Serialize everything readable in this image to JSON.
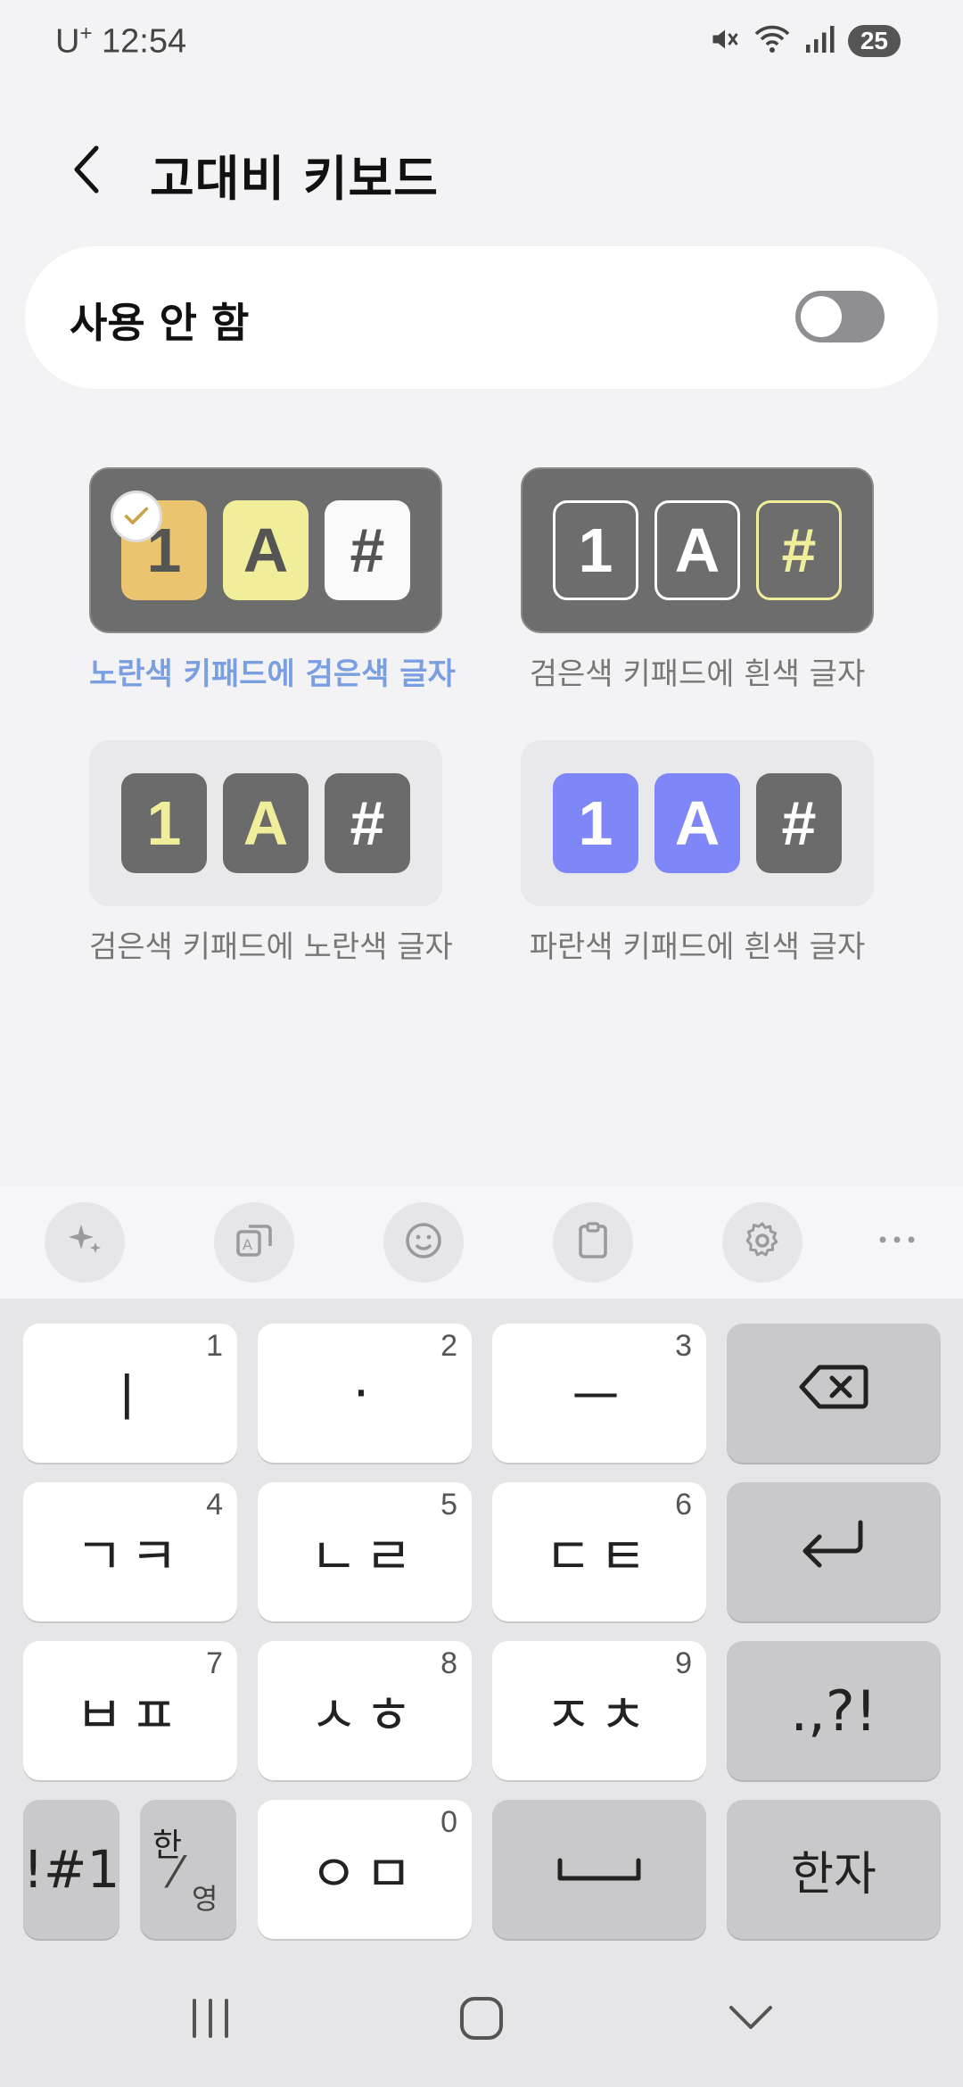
{
  "status_bar": {
    "carrier": "U",
    "carrier_sup": "+",
    "time": "12:54",
    "battery": "25",
    "icons": [
      "mute-icon",
      "wifi-icon",
      "signal-icon",
      "battery-icon"
    ]
  },
  "header": {
    "title": "고대비 키보드",
    "back_icon": "chevron-left-icon"
  },
  "toggle": {
    "label": "사용 안 함",
    "on": false
  },
  "themes": [
    {
      "caption": "노란색 키패드에 검은색 글자",
      "selected": true,
      "keys": [
        "1",
        "A",
        "#"
      ]
    },
    {
      "caption": "검은색 키패드에 흰색 글자",
      "selected": false,
      "keys": [
        "1",
        "A",
        "#"
      ]
    },
    {
      "caption": "검은색 키패드에 노란색 글자",
      "selected": false,
      "keys": [
        "1",
        "A",
        "#"
      ]
    },
    {
      "caption": "파란색 키패드에 흰색 글자",
      "selected": false,
      "keys": [
        "1",
        "A",
        "#"
      ]
    }
  ],
  "colors": {
    "accent": "#7a9fe0",
    "yellow_key": "#f0ee9a",
    "orange_key": "#eac46e",
    "dark_key": "#6b6b6b",
    "blue_key": "#7f86f8"
  },
  "keyboard_toolbar": [
    "sparkle-icon",
    "translate-icon",
    "emoji-icon",
    "clipboard-icon",
    "settings-icon",
    "more-icon"
  ],
  "keyboard": {
    "row1": [
      {
        "label": "ㅣ",
        "num": "1"
      },
      {
        "label": "·",
        "num": "2"
      },
      {
        "label": "ㅡ",
        "num": "3"
      }
    ],
    "row2": [
      {
        "label": "ㄱㅋ",
        "num": "4"
      },
      {
        "label": "ㄴㄹ",
        "num": "5"
      },
      {
        "label": "ㄷㅌ",
        "num": "6"
      }
    ],
    "row3": [
      {
        "label": "ㅂㅍ",
        "num": "7"
      },
      {
        "label": "ㅅㅎ",
        "num": "8"
      },
      {
        "label": "ㅈㅊ",
        "num": "9"
      }
    ],
    "punct": ".,?!",
    "symbols": "!#1",
    "lang_top": "한",
    "lang_bottom": "영",
    "zero": {
      "label": "ㅇㅁ",
      "num": "0"
    },
    "hanja": "한자"
  },
  "nav_bar": [
    "recents-icon",
    "home-icon",
    "back-icon"
  ]
}
